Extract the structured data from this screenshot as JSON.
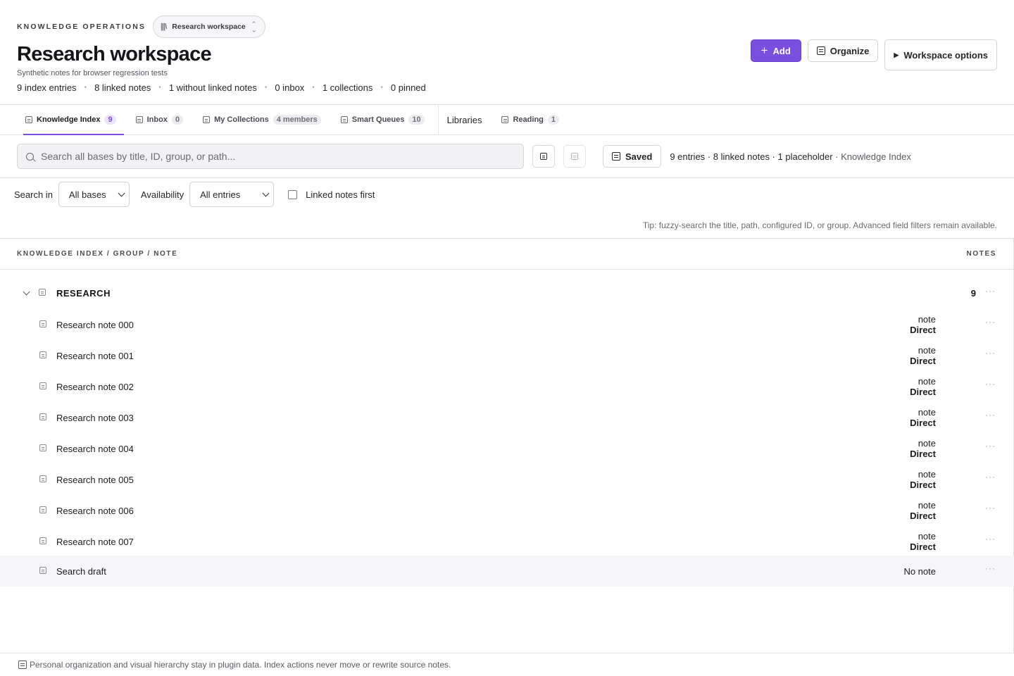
{
  "header": {
    "eyebrow": "KNOWLEDGE OPERATIONS",
    "workspace_pill": "Research workspace",
    "title": "Research workspace",
    "subtitle": "Synthetic notes for browser regression tests",
    "stats": [
      "9 index entries",
      "8 linked notes",
      "1 without linked notes",
      "0 inbox",
      "1 collections",
      "0 pinned"
    ]
  },
  "actions": {
    "add_label": "Add",
    "organize_label": "Organize",
    "workspace_options_label": "Workspace options"
  },
  "tabs": [
    {
      "label": "Knowledge Index",
      "badge": "9"
    },
    {
      "label": "Inbox",
      "badge": "0"
    },
    {
      "label": "My Collections",
      "badge": "4 members"
    },
    {
      "label": "Smart Queues",
      "badge": "10"
    },
    {
      "label": "Libraries"
    },
    {
      "label": "Reading",
      "badge": "1"
    }
  ],
  "search": {
    "placeholder": "Search all bases by title, ID, group, or path...",
    "saved_label": "Saved",
    "summary": "9 entries · 8 linked notes · 1 placeholder",
    "summary_scope": " · Knowledge Index"
  },
  "filters": {
    "search_in_label": "Search in",
    "search_in_value": "All bases",
    "availability_label": "Availability",
    "availability_value": "All entries",
    "linked_first_label": "Linked notes first",
    "tip": "Tip: fuzzy-search the title, path, configured ID, or group. Advanced field filters remain available."
  },
  "table": {
    "col_left": "KNOWLEDGE INDEX / GROUP / NOTE",
    "col_right": "NOTES",
    "group": {
      "name": "RESEARCH",
      "count": "9"
    },
    "rows": [
      {
        "title": "Research note 000",
        "kind": "note",
        "link": "Direct"
      },
      {
        "title": "Research note 001",
        "kind": "note",
        "link": "Direct"
      },
      {
        "title": "Research note 002",
        "kind": "note",
        "link": "Direct"
      },
      {
        "title": "Research note 003",
        "kind": "note",
        "link": "Direct"
      },
      {
        "title": "Research note 004",
        "kind": "note",
        "link": "Direct"
      },
      {
        "title": "Research note 005",
        "kind": "note",
        "link": "Direct"
      },
      {
        "title": "Research note 006",
        "kind": "note",
        "link": "Direct"
      },
      {
        "title": "Research note 007",
        "kind": "note",
        "link": "Direct"
      },
      {
        "title": "Search draft",
        "kind": "No note",
        "link": ""
      }
    ],
    "more_glyph": "···"
  },
  "footer": {
    "text": "Personal organization and visual hierarchy stay in plugin data. Index actions never move or rewrite source notes."
  },
  "colors": {
    "accent": "#7b4fde",
    "border": "#e2e2e6",
    "highlight_row": "#f6f6f8"
  }
}
